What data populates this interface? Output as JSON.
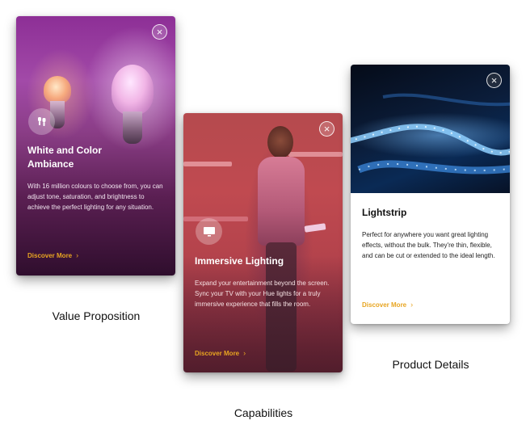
{
  "cards": [
    {
      "title": "White and Color Ambiance",
      "description": "With 16 million colours to choose from, you can adjust tone, saturation, and brightness to achieve the perfect lighting for any situation.",
      "cta_label": "Discover More",
      "cta_chevron": "›",
      "close_glyph": "×",
      "icon": "bulbs-icon",
      "caption": "Value Proposition"
    },
    {
      "title": "Immersive Lighting",
      "description": "Expand your entertainment beyond the screen. Sync your TV with your Hue lights for a truly immersive experience that fills the room.",
      "cta_label": "Discover More",
      "cta_chevron": "›",
      "close_glyph": "×",
      "icon": "tv-icon",
      "caption": "Capabilities"
    },
    {
      "title": "Lightstrip",
      "description": "Perfect for anywhere you want great lighting effects, without the bulk. They're thin, flexible, and can be cut or extended to the ideal length.",
      "cta_label": "Discover More",
      "cta_chevron": "›",
      "close_glyph": "×",
      "icon": "lightstrip-image",
      "caption": "Product Details"
    }
  ],
  "colors": {
    "accent": "#e8a521",
    "card1_base": "#8d2f96",
    "card2_base": "#b54a4e",
    "card3_hero": "#0b1d3a"
  }
}
